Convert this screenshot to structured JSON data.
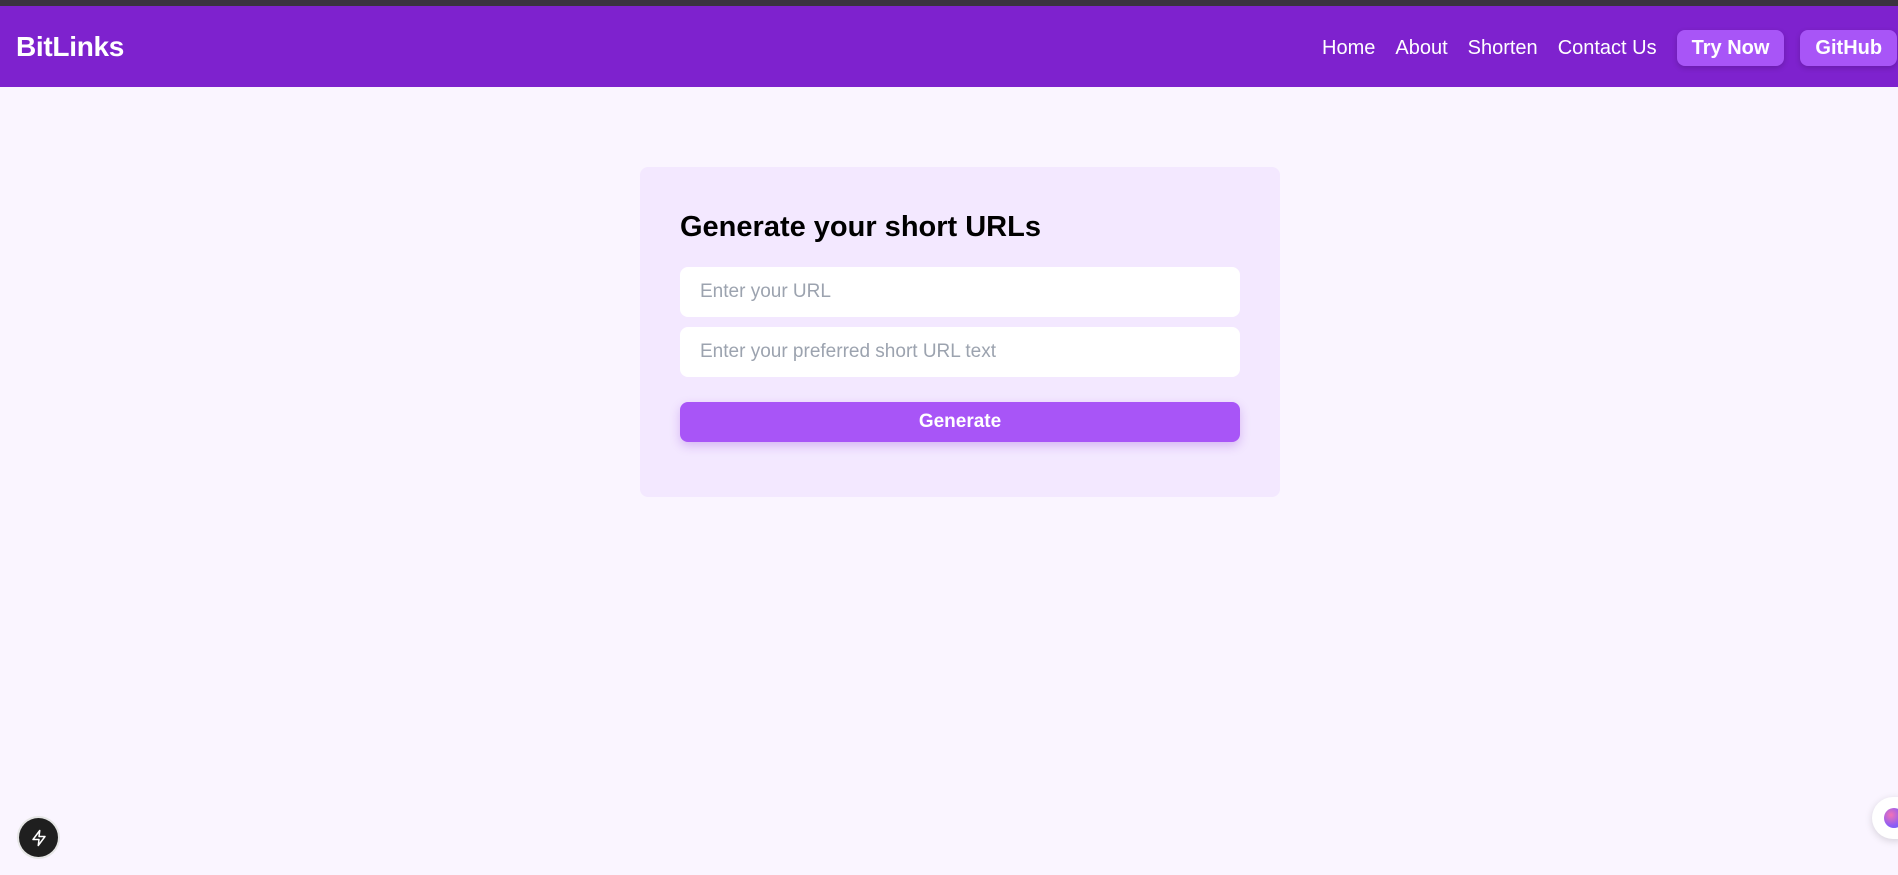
{
  "navbar": {
    "brand": "BitLinks",
    "links": [
      "Home",
      "About",
      "Shorten",
      "Contact Us"
    ],
    "try_now_label": "Try Now",
    "github_label": "GitHub"
  },
  "form": {
    "title": "Generate your short URLs",
    "url_placeholder": "Enter your URL",
    "url_value": "",
    "short_placeholder": "Enter your preferred short URL text",
    "short_value": "",
    "generate_label": "Generate"
  },
  "icons": {
    "dev_badge": "lightning-bolt-icon",
    "side_widget": "assistant-orb-icon"
  },
  "colors": {
    "navbar_bg": "#7e22ce",
    "accent": "#a855f7",
    "page_bg": "#faf5ff",
    "card_bg": "#f3e8ff"
  }
}
